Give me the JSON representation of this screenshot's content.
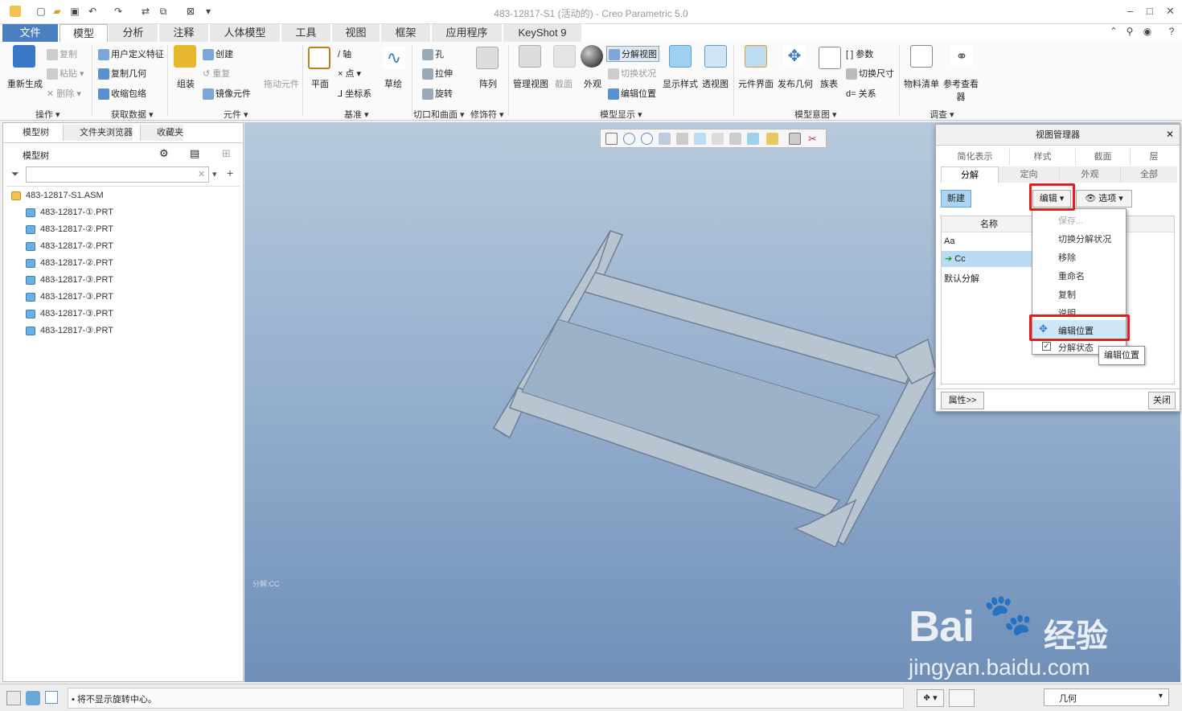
{
  "window": {
    "title": "483-12817-S1 (活动的) - Creo Parametric 5.0"
  },
  "menu": [
    "文件",
    "模型",
    "分析",
    "注释",
    "人体模型",
    "工具",
    "视图",
    "框架",
    "应用程序",
    "KeyShot 9"
  ],
  "ribbon": {
    "regen": "重新生成",
    "copy": "复制",
    "paste": "粘贴",
    "delete": "删除",
    "user_feature": "用户定义特征",
    "copy_geom": "复制几何",
    "shrinkwrap": "收缩包络",
    "assemble": "组装",
    "create": "创建",
    "repeat": "重复",
    "mirror": "镜像元件",
    "drag": "拖动元件",
    "plane": "平面",
    "axis": "轴",
    "point": "点",
    "csys": "坐标系",
    "sketch": "草绘",
    "hole": "孔",
    "extrude": "拉伸",
    "revolve": "旋转",
    "pattern": "阵列",
    "manage_view": "管理视图",
    "section": "截面",
    "appearance": "外观",
    "explode_view": "分解视图",
    "toggle_state": "切换状况",
    "edit_pos": "编辑位置",
    "display_style": "显示样式",
    "perspective": "透视图",
    "comp_interface": "元件界面",
    "publish_geom": "发布几何",
    "family_table": "族表",
    "params": "参数",
    "switch_dim": "切换尺寸",
    "relations": "关系",
    "bom": "物料清单",
    "ref_viewer": "参考查看器",
    "groups": [
      "操作",
      "获取数据",
      "元件",
      "基准",
      "切口和曲面",
      "修饰符",
      "模型显示",
      "模型意图",
      "调查"
    ]
  },
  "leftpanel": {
    "tabs": [
      "模型树",
      "文件夹浏览器",
      "收藏夹"
    ],
    "tree_label": "模型树",
    "root": "483-12817-S1.ASM",
    "items": [
      "483-12817-①.PRT",
      "483-12817-②.PRT",
      "483-12817-②.PRT",
      "483-12817-②.PRT",
      "483-12817-③.PRT",
      "483-12817-③.PRT",
      "483-12817-③.PRT",
      "483-12817-③.PRT"
    ]
  },
  "viewport": {
    "small_label": "分解:CC"
  },
  "view_manager": {
    "title": "视图管理器",
    "tabs_row1": [
      "简化表示",
      "样式",
      "截面",
      "层"
    ],
    "tabs_row2": [
      "分解",
      "定向",
      "外观",
      "全部"
    ],
    "new": "新建",
    "edit": "编辑",
    "options": "选项",
    "col_name": "名称",
    "rows": [
      "Aa",
      "Cc",
      "默认分解"
    ],
    "props": "属性>>",
    "close": "关闭"
  },
  "dropdown": {
    "items": [
      "保存...",
      "切换分解状况",
      "移除",
      "重命名",
      "复制",
      "说明",
      "编辑位置",
      "分解状态"
    ],
    "tooltip": "编辑位置"
  },
  "status": {
    "message": "• 将不显示旋转中心。",
    "filter": "几何"
  },
  "watermark": {
    "brand": "Bai",
    "brand2": "经验",
    "url": "jingyan.baidu.com"
  }
}
